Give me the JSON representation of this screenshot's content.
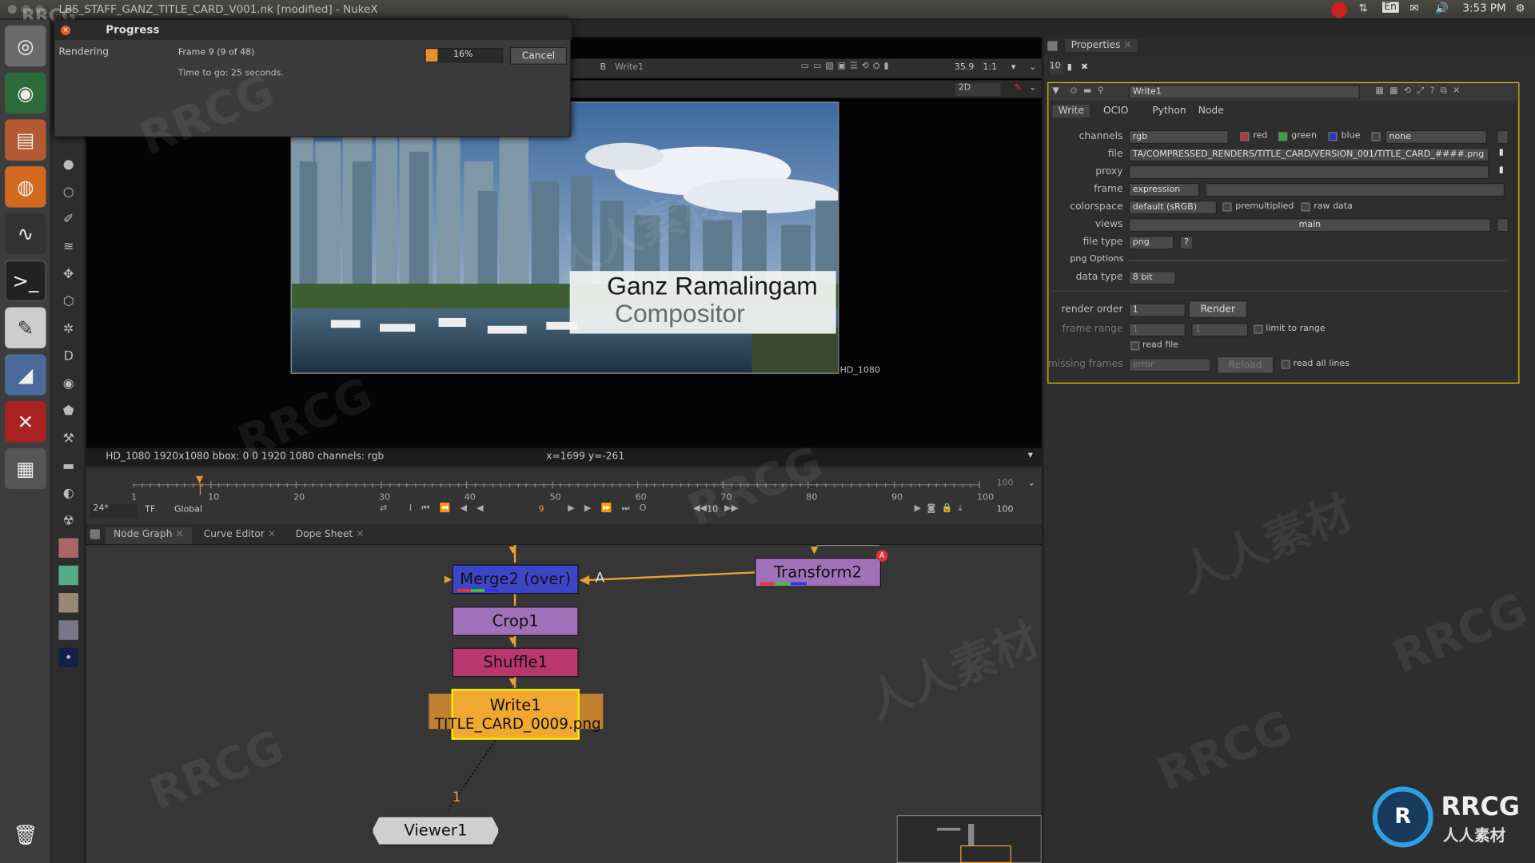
{
  "window": {
    "title": "LBS_STAFF_GANZ_TITLE_CARD_V001.nk [modified] - NukeX",
    "watermark_corner": "RRCG"
  },
  "tray": {
    "lang": "En",
    "time": "3:53 PM"
  },
  "progress_dialog": {
    "title": "Progress",
    "status": "Rendering",
    "frame_text": "Frame 9 (9 of 48)",
    "time_to_go": "Time to go: 25 seconds.",
    "percent": "16%",
    "progress_fraction": 0.16,
    "cancel": "Cancel"
  },
  "viewer": {
    "input_b": "B",
    "input_b_node": "Write1",
    "fstop": "35.9",
    "zoom": "1:1",
    "view_mode": "2D",
    "format_label": "HD_1080",
    "info_left": "HD_1080 1920x1080  bbox: 0 0 1920 1080 channels: rgb",
    "info_coords": "x=1699 y=-261",
    "title_line1": "Ganz Ramalingam",
    "title_line2": "Compositor"
  },
  "timeline": {
    "ticks": [
      "1",
      "10",
      "20",
      "30",
      "40",
      "50",
      "60",
      "70",
      "80",
      "90",
      "100"
    ],
    "end_frame": "100",
    "fps": "24*",
    "tf": "TF",
    "scope": "Global",
    "current_frame": "9",
    "step": "10",
    "out_frame": "100"
  },
  "node_graph": {
    "tabs": [
      "Node Graph",
      "Curve Editor",
      "Dope Sheet"
    ],
    "nodes": {
      "merge": "Merge2 (over)",
      "merge_input_a": "A",
      "transform": "Transform2",
      "transform_badge": "A",
      "crop": "Crop1",
      "shuffle": "Shuffle1",
      "write": "Write1",
      "write_file": "TITLE_CARD_0009.png",
      "viewer": "Viewer1",
      "viewer_input": "1"
    }
  },
  "properties": {
    "panel_title": "Properties",
    "max_panels": "10",
    "node_name": "Write1",
    "tabs": [
      "Write",
      "OCIO",
      "Python",
      "Node"
    ],
    "channels_label": "channels",
    "channels_value": "rgb",
    "chan_red": "red",
    "chan_green": "green",
    "chan_blue": "blue",
    "chan_extra": "none",
    "file_label": "file",
    "file_value": "TA/COMPRESSED_RENDERS/TITLE_CARD/VERSION_001/TITLE_CARD_####.png",
    "proxy_label": "proxy",
    "frame_label": "frame",
    "frame_value": "expression",
    "colorspace_label": "colorspace",
    "colorspace_value": "default (sRGB)",
    "premultiplied": "premultiplied",
    "raw_data": "raw data",
    "views_label": "views",
    "views_value": "main",
    "filetype_label": "file type",
    "filetype_value": "png",
    "help": "?",
    "png_options": "png Options",
    "datatype_label": "data type",
    "datatype_value": "8 bit",
    "render_order_label": "render order",
    "render_order_value": "1",
    "render_button": "Render",
    "frame_range_label": "frame range",
    "frame_range_start": "1",
    "frame_range_end": "1",
    "limit_to_range": "limit to range",
    "read_file": "read file",
    "missing_frames_label": "missing frames",
    "missing_frames_value": "error",
    "reload": "Reload",
    "read_all_lines": "read all lines"
  },
  "watermarks": {
    "rrcg": "RRCG",
    "cn": "人人素材"
  }
}
